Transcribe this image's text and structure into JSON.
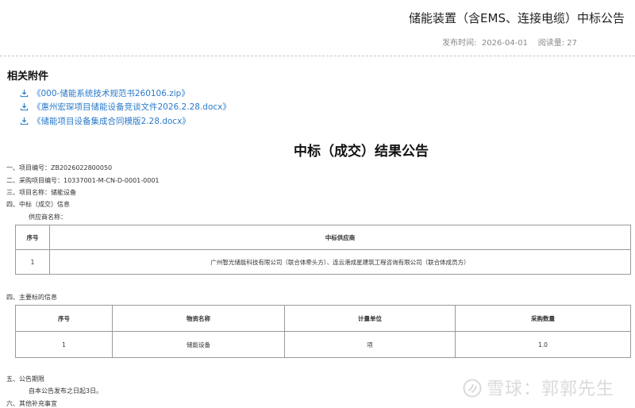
{
  "header": {
    "title": "储能装置（含EMS、连接电缆）中标公告",
    "meta": "发布时间:  2026-04-01    阅读量: 27"
  },
  "attachments": {
    "heading": "相关附件",
    "items": [
      "《000-储能系统技术规范书260106.zip》",
      "《惠州宏琛项目储能设备竞谈文件2026.2.28.docx》",
      "《储能项目设备集成合同模版2.28.docx》"
    ]
  },
  "doc": {
    "heading": "中标（成交）结果公告",
    "line1": "一、项目编号：ZB2026022800050",
    "line2": "二、采购项目编号：10337001-M-CN-D-0001-0001",
    "line3": "三、项目名称：储能设备",
    "line4": "四、中标（成交）信息",
    "supplier_label": "供应商名称：",
    "table1": {
      "headers": [
        "序号",
        "中标供应商"
      ],
      "rows": [
        [
          "1",
          "广州智光储能科技有限公司（联合体牵头方）、连云港成星建筑工程咨询有限公司（联合体成员方）"
        ]
      ]
    },
    "line5": "四、主要标的信息",
    "table2": {
      "headers": [
        "序号",
        "物资名称",
        "计量单位",
        "采购数量"
      ],
      "rows": [
        [
          "1",
          "储能设备",
          "项",
          "1.0"
        ]
      ]
    },
    "line6": "五、公告期限",
    "line7": "自本公告发布之日起3日。",
    "line8": "六、其他补充事宜"
  },
  "watermark": "雪球：郭郭先生"
}
